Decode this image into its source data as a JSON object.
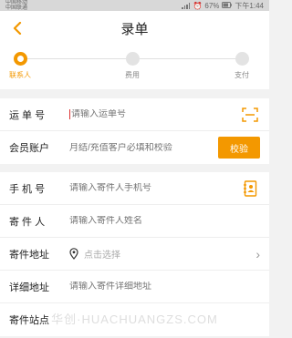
{
  "status_bar": {
    "carrier_top": "中国移动",
    "carrier_bottom": "中国联通",
    "battery": "67%",
    "time": "下午1:44"
  },
  "nav": {
    "title": "录单",
    "back_icon": "chevron-left-icon"
  },
  "steps": [
    {
      "label": "联系人",
      "active": true
    },
    {
      "label": "费用",
      "active": false
    },
    {
      "label": "支付",
      "active": false
    }
  ],
  "form": {
    "waybill": {
      "label": "运 单 号",
      "placeholder": "请输入运单号",
      "icon": "scan-icon"
    },
    "member": {
      "label": "会员账户",
      "hint": "月结/充值客户必填和校验",
      "button": "校验"
    },
    "phone": {
      "label": "手 机 号",
      "placeholder": "请输入寄件人手机号",
      "icon": "contact-book-icon"
    },
    "sender": {
      "label": "寄 件 人",
      "placeholder": "请输入寄件人姓名"
    },
    "address": {
      "label": "寄件地址",
      "placeholder": "点击选择"
    },
    "detail": {
      "label": "详细地址",
      "placeholder": "请输入寄件详细地址"
    },
    "site": {
      "label": "寄件站点"
    }
  },
  "watermark": "华创·HUACHUANGZS.COM",
  "colors": {
    "accent": "#f39800",
    "cursor": "#d33333"
  }
}
